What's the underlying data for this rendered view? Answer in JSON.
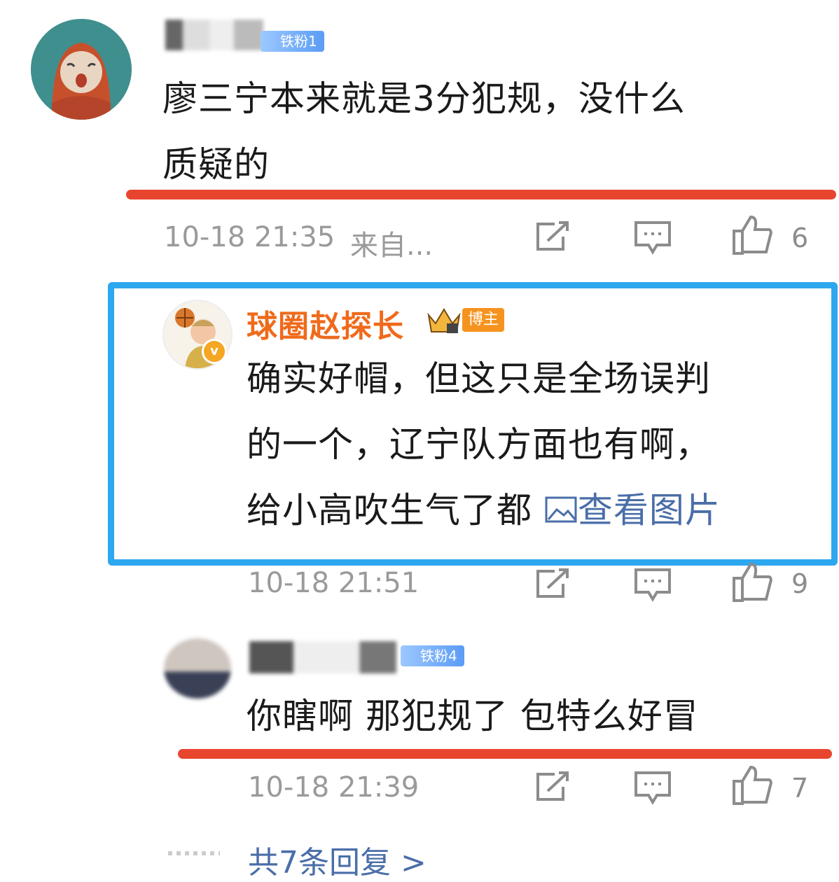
{
  "comments": [
    {
      "fan_badge": "铁粉1",
      "text_line1": "廖三宁本来就是3分犯规，没什么",
      "text_line2": "质疑的",
      "time": "10-18 21:35",
      "source": "来自...",
      "likes": "6"
    },
    {
      "author": "球圈赵探长",
      "role_badge": "博主",
      "text_line1": "确实好帽，但这只是全场误判",
      "text_line2": "的一个，辽宁队方面也有啊，",
      "text_line3": "给小高吹生气了都",
      "view_image": "查看图片",
      "time": "10-18 21:51",
      "likes": "9"
    },
    {
      "fan_badge": "铁粉4",
      "text": "你瞎啊 那犯规了 包特么好冒",
      "time": "10-18 21:39",
      "likes": "7"
    }
  ],
  "footer": {
    "more_replies": "共7条回复 >"
  },
  "colors": {
    "highlight_red": "#e8452f",
    "highlight_blue": "#2da7ef",
    "author_orange": "#ef6a1b",
    "link_blue": "#4a6ea8"
  },
  "icons": [
    "share-icon",
    "comment-icon",
    "like-icon",
    "image-icon",
    "crown-icon",
    "verified-icon"
  ]
}
